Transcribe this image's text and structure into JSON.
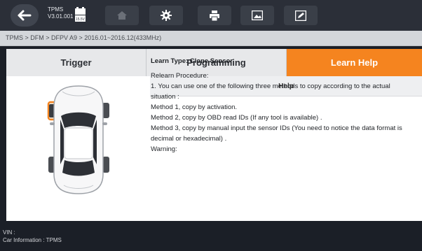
{
  "header": {
    "app_name": "TPMS",
    "version": "V3.01.001",
    "battery_voltage": "15.5V",
    "icons": [
      "back-arrow-icon",
      "home-icon",
      "gear-icon",
      "printer-icon",
      "image-icon",
      "edit-icon"
    ]
  },
  "breadcrumb": "TPMS > DFM > DFPV A9 > 2016.01~2016.12(433MHz)",
  "tabs": [
    {
      "label": "Trigger",
      "active": false
    },
    {
      "label": "Programming",
      "active": false
    },
    {
      "label": "Learn Help",
      "active": true
    }
  ],
  "help": {
    "title": "Help",
    "learn_type": "Learn Type:  Clone Sensor",
    "lines": [
      "Relearn Procedure:",
      "1. You can use one of the following three methods to copy according to the actual situation :",
      "Method 1, copy by activation.",
      "Method 2, copy by OBD read IDs (If any tool is available) .",
      "Method 3, copy by manual input the sensor IDs (You need to notice the data format is decimal or hexadecimal) .",
      "Warning:"
    ]
  },
  "footer": {
    "vin": "VIN :",
    "car_info": "Car Information : TPMS"
  },
  "colors": {
    "accent": "#f5841f",
    "toolbar": "#2b2f38",
    "background": "#1b1f27"
  }
}
